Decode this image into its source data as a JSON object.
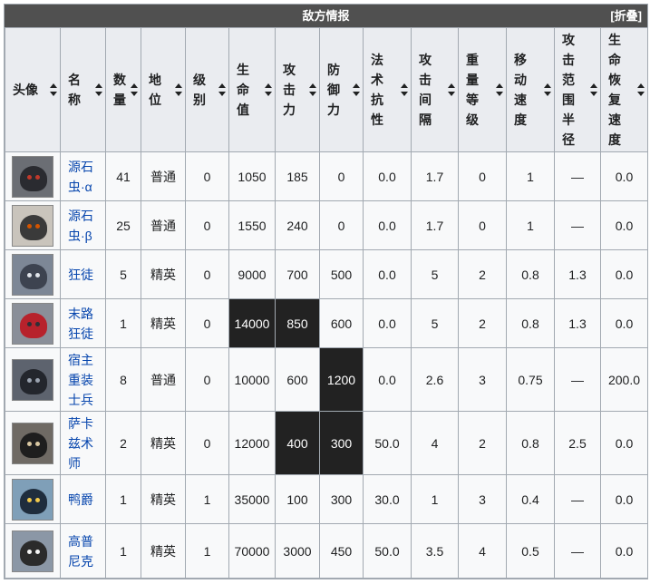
{
  "panel": {
    "title": "敌方情报",
    "toggle": "[折叠]"
  },
  "headers": [
    "头像",
    "名称",
    "数量",
    "地位",
    "级别",
    "生命值",
    "攻击力",
    "防御力",
    "法术抗性",
    "攻击间隔",
    "重量等级",
    "移动速度",
    "攻击范围半径",
    "生命恢复速度"
  ],
  "rows": [
    {
      "name": "源石虫·α",
      "cells": [
        "41",
        "普通",
        "0",
        "1050",
        "185",
        "0",
        "0.0",
        "1.7",
        "0",
        "1",
        "—",
        "0.0"
      ],
      "avatar": {
        "bg": "#6b6e74",
        "fg": "#2a2b30",
        "accent": "#c0392b"
      }
    },
    {
      "name": "源石虫·β",
      "cells": [
        "25",
        "普通",
        "0",
        "1550",
        "240",
        "0",
        "0.0",
        "1.7",
        "0",
        "1",
        "—",
        "0.0"
      ],
      "avatar": {
        "bg": "#c9c4bc",
        "fg": "#3a3a3a",
        "accent": "#d35400"
      }
    },
    {
      "name": "狂徒",
      "cells": [
        "5",
        "精英",
        "0",
        "9000",
        "700",
        "500",
        "0.0",
        "5",
        "2",
        "0.8",
        "1.3",
        "0.0"
      ],
      "avatar": {
        "bg": "#7d8796",
        "fg": "#3d4350",
        "accent": "#e0e4ea"
      }
    },
    {
      "name": "末路狂徒",
      "cells": [
        "1",
        "精英",
        "0",
        "14000",
        "850",
        "600",
        "0.0",
        "5",
        "2",
        "0.8",
        "1.3",
        "0.0"
      ],
      "avatar": {
        "bg": "#8a8f99",
        "fg": "#b7222c",
        "accent": "#2d2f36"
      }
    },
    {
      "name": "宿主重装士兵",
      "cells": [
        "8",
        "普通",
        "0",
        "10000",
        "600",
        "1200",
        "0.0",
        "2.6",
        "3",
        "0.75",
        "—",
        "200.0"
      ],
      "avatar": {
        "bg": "#5d636e",
        "fg": "#23262d",
        "accent": "#9aa3b0"
      }
    },
    {
      "name": "萨卡兹术师",
      "cells": [
        "2",
        "精英",
        "0",
        "12000",
        "400",
        "300",
        "50.0",
        "4",
        "2",
        "0.8",
        "2.5",
        "0.0"
      ],
      "avatar": {
        "bg": "#6f6a64",
        "fg": "#1e1e1e",
        "accent": "#d9c7a2"
      }
    },
    {
      "name": "鸭爵",
      "cells": [
        "1",
        "精英",
        "1",
        "35000",
        "100",
        "300",
        "30.0",
        "1",
        "3",
        "0.4",
        "—",
        "0.0"
      ],
      "avatar": {
        "bg": "#7f9fb8",
        "fg": "#1f2d3d",
        "accent": "#f2c94c"
      }
    },
    {
      "name": "高普尼克",
      "cells": [
        "1",
        "精英",
        "1",
        "70000",
        "3000",
        "450",
        "50.0",
        "3.5",
        "4",
        "0.5",
        "—",
        "0.0"
      ],
      "avatar": {
        "bg": "#8b97a6",
        "fg": "#2b2b2b",
        "accent": "#f5f5f5"
      }
    }
  ],
  "highlight_color": "#222222"
}
